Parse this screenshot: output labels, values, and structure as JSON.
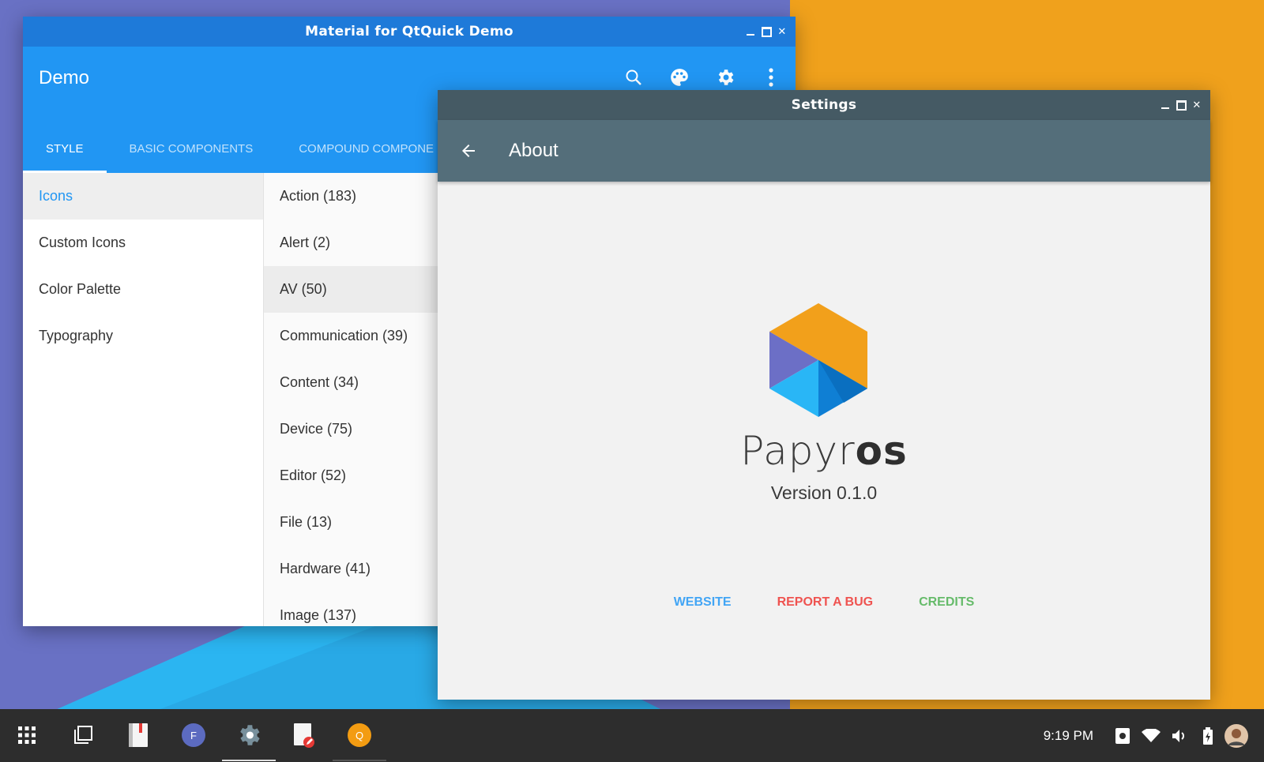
{
  "demo_window": {
    "title": "Material for QtQuick Demo",
    "appbar_title": "Demo",
    "actions": [
      "search-icon",
      "palette-icon",
      "settings-icon",
      "more-vert-icon"
    ],
    "tabs": [
      {
        "label": "STYLE",
        "active": true
      },
      {
        "label": "BASIC COMPONENTS",
        "active": false
      },
      {
        "label": "COMPOUND COMPONE",
        "active": false
      }
    ],
    "sidebar": [
      {
        "label": "Icons",
        "active": true
      },
      {
        "label": "Custom Icons",
        "active": false
      },
      {
        "label": "Color Palette",
        "active": false
      },
      {
        "label": "Typography",
        "active": false
      }
    ],
    "categories": [
      {
        "label": "Action (183)"
      },
      {
        "label": "Alert (2)"
      },
      {
        "label": "AV (50)",
        "active": true
      },
      {
        "label": "Communication (39)"
      },
      {
        "label": "Content (34)"
      },
      {
        "label": "Device (75)"
      },
      {
        "label": "Editor (52)"
      },
      {
        "label": "File (13)"
      },
      {
        "label": "Hardware (41)"
      },
      {
        "label": "Image (137)"
      }
    ]
  },
  "settings_window": {
    "title": "Settings",
    "page_title": "About",
    "brand_light": "Papyr",
    "brand_bold": "os",
    "version": "Version 0.1.0",
    "links": {
      "website": "WEBSITE",
      "report_bug": "REPORT A BUG",
      "credits": "CREDITS"
    }
  },
  "taskbar": {
    "apps": [
      "app-launcher-icon",
      "window-switcher-icon",
      "book-reader-icon",
      "F",
      "settings-icon",
      "text-editor-icon",
      "Q"
    ],
    "clock": "9:19 PM",
    "tray": [
      "screenshot-icon",
      "wifi-icon",
      "volume-icon",
      "battery-icon",
      "user-avatar"
    ]
  },
  "colors": {
    "demo_primary": "#2196f3",
    "demo_titlebar": "#1e7ad9",
    "settings_titlebar": "#455a64",
    "settings_primary": "#546e7a",
    "link_website": "#42a5f5",
    "link_bug": "#ef5350",
    "link_credits": "#66bb6a",
    "desktop_orange": "#f0a11c",
    "desktop_purple": "#6971c4",
    "desktop_blue": "#2bb5f1"
  }
}
